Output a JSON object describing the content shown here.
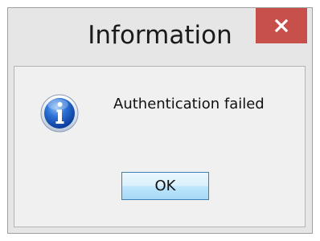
{
  "dialog": {
    "title": "Information",
    "message": "Authentication failed",
    "ok_label": "OK",
    "icon": "info-icon",
    "close_icon": "close-icon"
  },
  "colors": {
    "close_button": "#c7504a",
    "frame": "#e6e6e6",
    "client": "#f0f0f0",
    "ok_border": "#3c7fb1"
  }
}
